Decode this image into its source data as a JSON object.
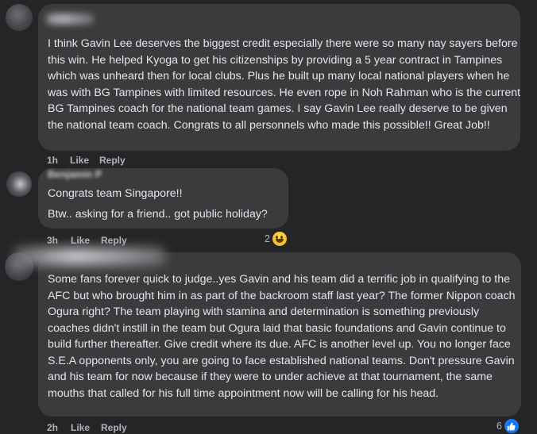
{
  "comments": [
    {
      "text": "I think Gavin Lee deserves the biggest credit especially there were so many nay sayers before this win. He helped Kyoga to get his citizenships by providing a 5 year contract in Tampines which was unheard then for local clubs. Plus he built up many local national players when he was with BG Tampines with limited resources. He even rope in Noh Rahman who is the current BG Tampines coach for the national team games. I say Gavin Lee really deserve to be given the national team coach. Congrats to all personnels who made this possible!! Great Job!!",
      "time": "1h",
      "like_label": "Like",
      "reply_label": "Reply"
    },
    {
      "author": "Benjamin P",
      "line1": "Congrats team Singapore!!",
      "line2": "Btw.. asking for a friend.. got public holiday?",
      "time": "3h",
      "like_label": "Like",
      "reply_label": "Reply",
      "reaction_count": "2",
      "reaction_icon": "haha-emoji-icon"
    },
    {
      "text": "Some fans forever quick to judge..yes Gavin and his team did a terrific job in qualifying to the AFC but who brought him in as part of the backroom staff last year? The former Nippon coach Ogura right? The team playing with stamina and determination is something previously coaches didn't instill in the team but Ogura laid that basic foundations and Gavin continue to build further thereafter. Give credit where its due. AFC is another level up. You no longer face S.E.A opponents only, you are going to face established national teams. Don't pressure Gavin and his team for now because if they were to under achieve at that tournament, the same mouths that called for his full time appointment now will be calling for his head.",
      "time": "2h",
      "like_label": "Like",
      "reply_label": "Reply",
      "reaction_count": "6",
      "reaction_icon": "like-thumb-icon"
    }
  ],
  "colors": {
    "background": "#242526",
    "bubble": "#3a3b3c",
    "text": "#e4e6eb",
    "secondary": "#b0b3b8",
    "like_blue": "#1877f2"
  }
}
